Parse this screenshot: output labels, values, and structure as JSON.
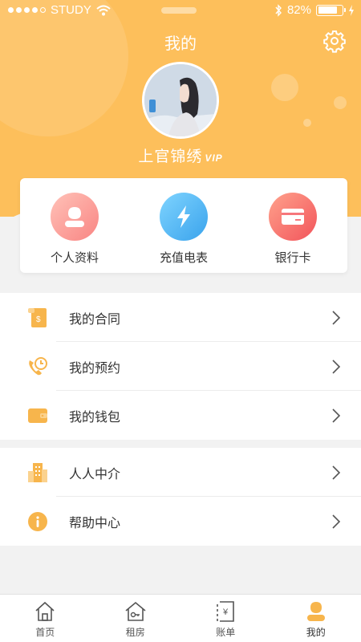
{
  "status_bar": {
    "carrier": "STUDY",
    "battery": "82%"
  },
  "header": {
    "title": "我的",
    "username": "上官锦绣",
    "badge": "VIP"
  },
  "quick_actions": [
    {
      "label": "个人资料",
      "icon": "profile-icon"
    },
    {
      "label": "充值电表",
      "icon": "lightning-icon"
    },
    {
      "label": "银行卡",
      "icon": "bank-card-icon"
    }
  ],
  "menu_group_1": [
    {
      "label": "我的合同",
      "icon": "contract-icon"
    },
    {
      "label": "我的预约",
      "icon": "appointment-icon"
    },
    {
      "label": "我的钱包",
      "icon": "wallet-icon"
    }
  ],
  "menu_group_2": [
    {
      "label": "人人中介",
      "icon": "agency-icon"
    },
    {
      "label": "帮助中心",
      "icon": "help-icon"
    }
  ],
  "tabs": [
    {
      "label": "首页",
      "icon": "home-icon"
    },
    {
      "label": "租房",
      "icon": "rent-house-icon"
    },
    {
      "label": "账单",
      "icon": "bill-icon"
    },
    {
      "label": "我的",
      "icon": "user-icon",
      "active": true
    }
  ],
  "colors": {
    "primary": "#fdbf5b",
    "background": "#f2f2f2",
    "accent_icon": "#f7b54c"
  }
}
